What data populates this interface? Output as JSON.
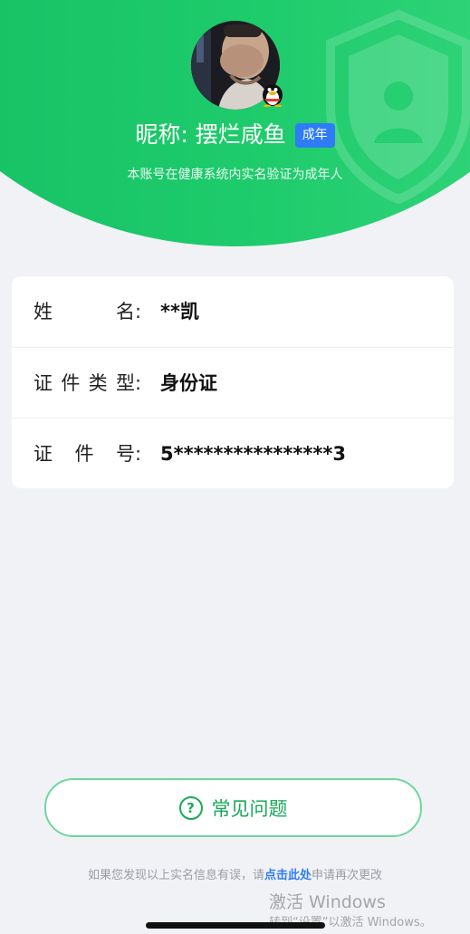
{
  "profile": {
    "nickname": "昵称: 摆烂咸鱼",
    "badge": "成年",
    "subtitle": "本账号在健康系统内实名验证为成年人",
    "avatar_icon": "user-avatar",
    "badge_icon": "qq-penguin-icon"
  },
  "info_rows": [
    {
      "label_chars": [
        "姓",
        "名"
      ],
      "colon": ":",
      "value": "**凯"
    },
    {
      "label_chars": [
        "证",
        "件",
        "类",
        "型"
      ],
      "colon": ":",
      "value": "身份证"
    },
    {
      "label_chars": [
        "证",
        "件",
        "号"
      ],
      "colon": ":",
      "value": "5****************3"
    }
  ],
  "faq": {
    "icon": "question-circle-icon",
    "icon_glyph": "?",
    "label": "常见问题"
  },
  "footer": {
    "before": "如果您发现以上实名信息有误，请",
    "link": "点击此处",
    "after": "申请再次更改"
  },
  "watermark": {
    "title": "激活 Windows",
    "subtitle": "转到“设置”以激活 Windows。"
  },
  "colors": {
    "header_green": "#1fcc6c",
    "badge_blue": "#2e7cf6",
    "faq_green": "#1aa85a",
    "background": "#f1f2f6"
  }
}
